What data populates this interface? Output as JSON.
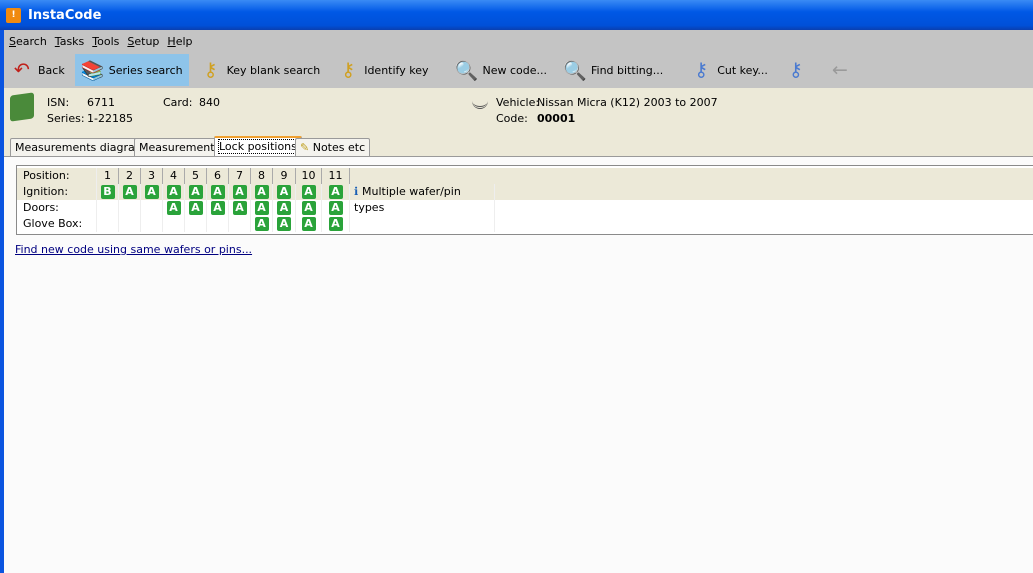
{
  "window": {
    "title": "InstaCode"
  },
  "menu": [
    "Search",
    "Tasks",
    "Tools",
    "Setup",
    "Help"
  ],
  "toolbar": [
    {
      "label": "Back",
      "icon": "back-arrow-icon",
      "glyph": "↶",
      "color": "#c0201a"
    },
    {
      "label": "Series search",
      "icon": "books-icon",
      "glyph": "📚",
      "color": "#3a8a3a",
      "active": true
    },
    {
      "label": "Key blank search",
      "icon": "keys-icon",
      "glyph": "⚷",
      "color": "#d0a020"
    },
    {
      "label": "Identify key",
      "icon": "key-check-icon",
      "glyph": "⚷",
      "color": "#d0a020"
    },
    {
      "label": "New code...",
      "icon": "map-magnifier-icon",
      "glyph": "🔍",
      "color": "#3a8a3a"
    },
    {
      "label": "Find bitting...",
      "icon": "find-bitting-icon",
      "glyph": "🔍",
      "color": "#d08020"
    },
    {
      "label": "Cut key...",
      "icon": "cut-key-icon",
      "glyph": "⚷",
      "color": "#4a7ad0"
    },
    {
      "label": "",
      "icon": "key-compare-icon",
      "glyph": "⚷",
      "color": "#4a7ad0"
    },
    {
      "label": "",
      "icon": "forward-disabled-icon",
      "glyph": "←",
      "color": "#9a9a9a"
    }
  ],
  "info": {
    "isn_label": "ISN:",
    "isn": "6711",
    "card_label": "Card:",
    "card": "840",
    "series_label": "Series:",
    "series": "1-22185",
    "vehicle_label": "Vehicle:",
    "vehicle": "Nissan Micra (K12) 2003 to 2007",
    "code_label": "Code:",
    "code": "00001"
  },
  "tabs": [
    "Measurements diagram",
    "Measurements",
    "Lock positions",
    "Notes etc"
  ],
  "lock_positions": {
    "header": "Position:",
    "positions": [
      "1",
      "2",
      "3",
      "4",
      "5",
      "6",
      "7",
      "8",
      "9",
      "10",
      "11"
    ],
    "rows": [
      {
        "label": "Ignition:",
        "cells": [
          "B",
          "A",
          "A",
          "A",
          "A",
          "A",
          "A",
          "A",
          "A",
          "A",
          "A"
        ],
        "note": "Multiple wafer/pin types"
      },
      {
        "label": "Doors:",
        "cells": [
          "",
          "",
          "",
          "A",
          "A",
          "A",
          "A",
          "A",
          "A",
          "A",
          "A"
        ],
        "note": ""
      },
      {
        "label": "Glove Box:",
        "cells": [
          "",
          "",
          "",
          "",
          "",
          "",
          "",
          "A",
          "A",
          "A",
          "A"
        ],
        "note": ""
      }
    ]
  },
  "link": "Find new code using same wafers or pins..."
}
